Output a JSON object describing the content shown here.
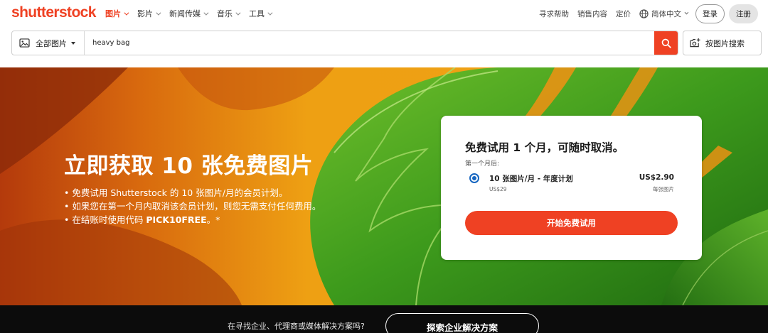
{
  "brand": {
    "logo_text": "shutterstock",
    "accent": "#ef4123"
  },
  "nav": {
    "items": [
      {
        "label": "图片",
        "active": true
      },
      {
        "label": "影片",
        "active": false
      },
      {
        "label": "新闻传媒",
        "active": false
      },
      {
        "label": "音乐",
        "active": false
      },
      {
        "label": "工具",
        "active": false
      }
    ],
    "right": {
      "help": "寻求帮助",
      "sell": "销售内容",
      "pricing": "定价",
      "language": "简体中文",
      "login": "登录",
      "register": "注册"
    }
  },
  "search": {
    "type_label": "全部图片",
    "query": "heavy bag",
    "image_search_label": "按图片搜索"
  },
  "hero": {
    "title": "立即获取 10 张免费图片",
    "bullet_1": "• 免费试用 Shutterstock 的 10 张图片/月的会员计划。",
    "bullet_2": "• 如果您在第一个月内取消该会员计划，则您无需支付任何费用。",
    "bullet_3_prefix": "• 在结账时使用代码 ",
    "bullet_3_code": "PICK10FREE",
    "bullet_3_suffix": "。*"
  },
  "offer": {
    "title": "免费试用 1 个月，可随时取消。",
    "subtitle": "第一个月后:",
    "plan_name": "10 张图片/月 - 年度计划",
    "plan_subprice": "US$29",
    "plan_price": "US$2.90",
    "plan_unit": "每张图片",
    "cta": "开始免费试用"
  },
  "bottom": {
    "question": "在寻找企业、代理商或媒体解决方案吗?",
    "cta": "探索企业解决方案"
  }
}
